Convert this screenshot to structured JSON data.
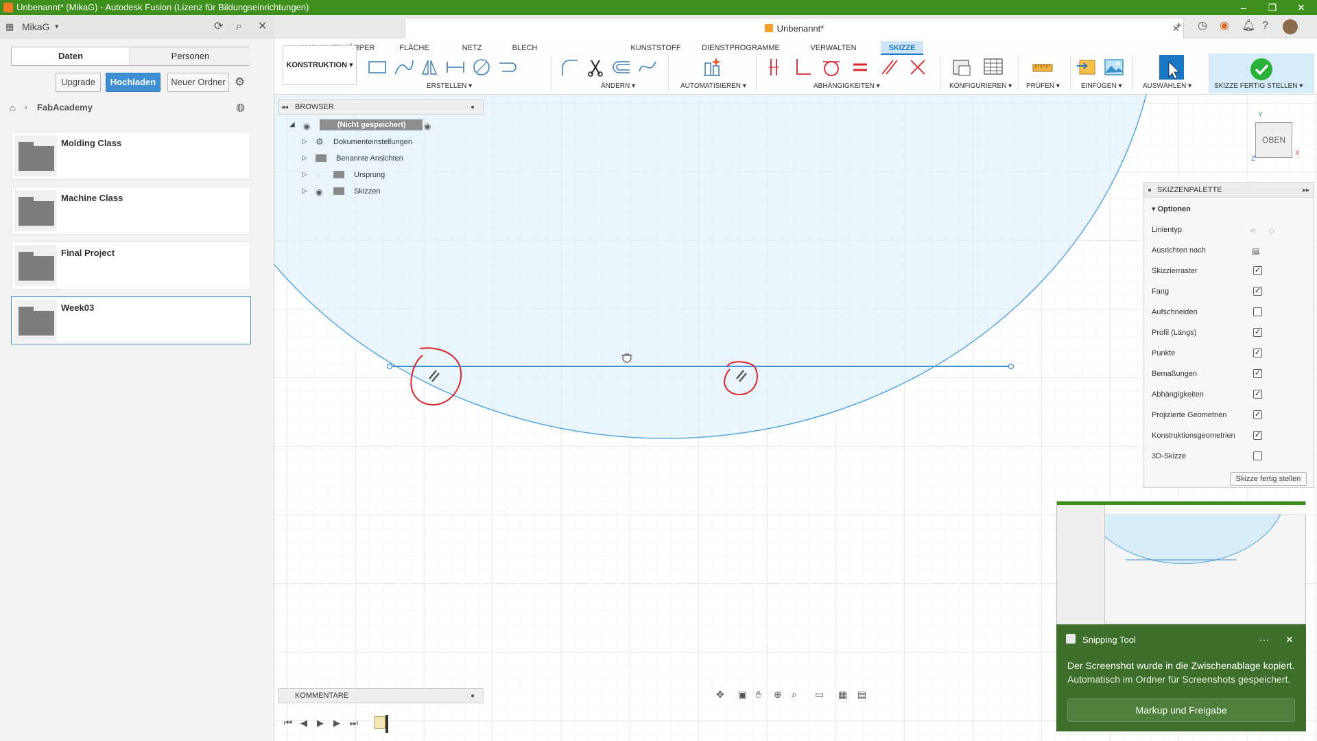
{
  "window": {
    "title": "Unbenannt* (MikaG) - Autodesk Fusion (Lizenz für Bildungseinrichtungen)",
    "controls": [
      "–",
      "❐",
      "✕"
    ]
  },
  "data_panel": {
    "user": "MikaG",
    "tabs": [
      "Daten",
      "Personen"
    ],
    "buttons": {
      "upgrade": "Upgrade",
      "upload": "Hochladen",
      "new_folder": "Neuer Ordner"
    },
    "breadcrumb": "FabAcademy",
    "folders": [
      {
        "name": "Molding Class"
      },
      {
        "name": "Machine Class"
      },
      {
        "name": "Final Project"
      },
      {
        "name": "Week03"
      }
    ]
  },
  "document": {
    "title": "Unbenannt*"
  },
  "ribbon": {
    "tabs": [
      "VOLUMENKÖRPER",
      "FLÄCHE",
      "NETZ",
      "BLECH",
      "KUNSTSTOFF",
      "DIENSTPROGRAMME",
      "VERWALTEN",
      "SKIZZE"
    ],
    "active_tab": "SKIZZE",
    "workspace": "KONSTRUKTION",
    "groups": [
      "ERSTELLEN",
      "ÄNDERN",
      "AUTOMATISIEREN",
      "ABHÄNGIGKEITEN",
      "KONFIGURIEREN",
      "PRÜFEN",
      "EINFÜGEN",
      "AUSWÄHLEN",
      "SKIZZE FERTIG STELLEN"
    ]
  },
  "browser": {
    "title": "BROWSER",
    "root": "(Nicht gespeichert)",
    "items": [
      "Dokumenteinstellungen",
      "Benannte Ansichten",
      "Ursprung",
      "Skizzen"
    ]
  },
  "viewcube": {
    "face": "OBEN",
    "axes": {
      "x": "X",
      "y": "Y",
      "z": "Z"
    }
  },
  "palette": {
    "title": "SKIZZENPALETTE",
    "section": "Optionen",
    "options": [
      {
        "label": "Linientyp",
        "kind": "icons"
      },
      {
        "label": "Ausrichten nach",
        "kind": "icon"
      },
      {
        "label": "Skizzierraster",
        "kind": "check",
        "checked": true
      },
      {
        "label": "Fang",
        "kind": "check",
        "checked": true
      },
      {
        "label": "Aufschneiden",
        "kind": "check",
        "checked": false
      },
      {
        "label": "Profil (Längs)",
        "kind": "check",
        "checked": true
      },
      {
        "label": "Punkte",
        "kind": "check",
        "checked": true
      },
      {
        "label": "Bemaßungen",
        "kind": "check",
        "checked": true
      },
      {
        "label": "Abhängigkeiten",
        "kind": "check",
        "checked": true
      },
      {
        "label": "Projizierte Geometrien",
        "kind": "check",
        "checked": true
      },
      {
        "label": "Konstruktionsgeometrien",
        "kind": "check",
        "checked": true
      },
      {
        "label": "3D-Skizze",
        "kind": "check",
        "checked": false
      }
    ],
    "finish_button": "Skizze fertig stellen"
  },
  "comments": {
    "title": "KOMMENTARE"
  },
  "toast": {
    "app": "Snipping Tool",
    "more": "···",
    "close": "✕",
    "line1": "Der Screenshot wurde in die Zwischenablage kopiert.",
    "line2": "Automatisch im Ordner für Screenshots gespeichert.",
    "action": "Markup und Freigabe"
  },
  "colors": {
    "title_bar": "#3f8f1e",
    "accent_blue": "#3d8ed3",
    "sketch_blue": "#4aa3df",
    "annotation_red": "#d9232b",
    "toast_green": "#3d6e2c"
  }
}
